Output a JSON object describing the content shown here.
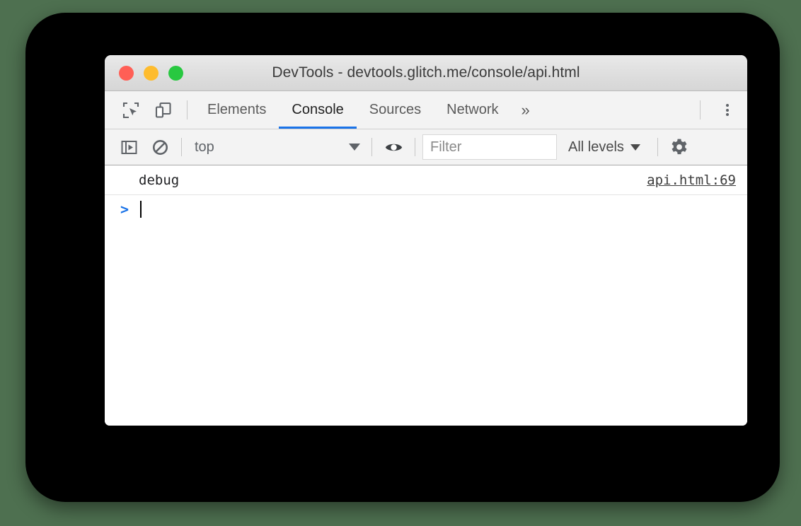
{
  "window": {
    "title": "DevTools - devtools.glitch.me/console/api.html",
    "traffic_lights": [
      {
        "name": "close",
        "color": "#ff5f56"
      },
      {
        "name": "minimize",
        "color": "#febc2e"
      },
      {
        "name": "maximize",
        "color": "#28c840"
      }
    ]
  },
  "tabbar": {
    "icons": [
      {
        "name": "inspect-element-icon"
      },
      {
        "name": "device-toolbar-icon"
      }
    ],
    "tabs": [
      {
        "label": "Elements",
        "active": false
      },
      {
        "label": "Console",
        "active": true
      },
      {
        "label": "Sources",
        "active": false
      },
      {
        "label": "Network",
        "active": false
      }
    ],
    "overflow_label": "»",
    "more_menu": "main-menu-icon",
    "active_tab_color": "#1a73e8"
  },
  "console_toolbar": {
    "sidebar_toggle": "console-sidebar-icon",
    "clear_console": "clear-console-icon",
    "context": {
      "value": "top",
      "caret": "▼"
    },
    "live_expression": "eye-icon",
    "filter": {
      "value": "",
      "placeholder": "Filter"
    },
    "levels": {
      "value": "All levels",
      "caret": "▼"
    },
    "settings": "gear-icon"
  },
  "console": {
    "messages": [
      {
        "text": "debug",
        "source": "api.html:69"
      }
    ],
    "prompt": {
      "chevron": "›",
      "input_value": ""
    }
  },
  "colors": {
    "page_background": "#4e7050",
    "frame": "#000000",
    "window_background": "#ffffff",
    "toolbar_background": "#f3f3f3",
    "accent": "#1a73e8",
    "icon": "#5f6368"
  }
}
